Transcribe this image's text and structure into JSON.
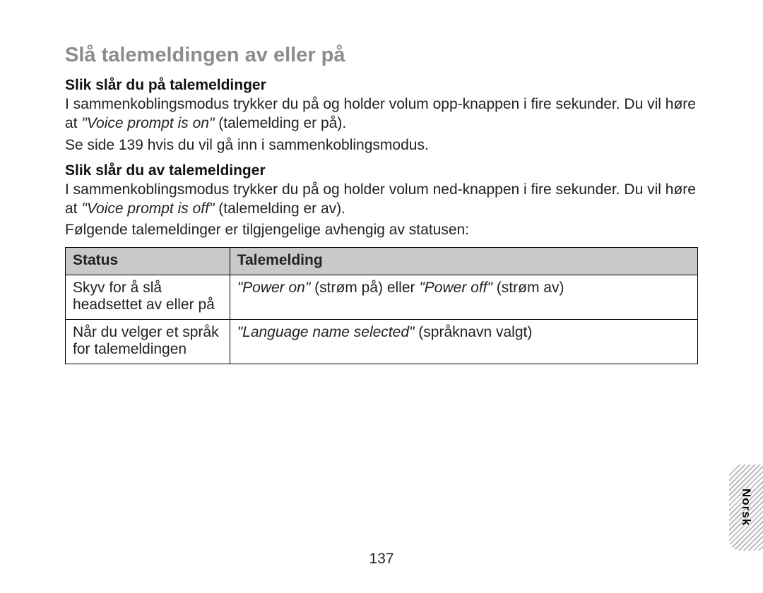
{
  "title": "Slå talemeldingen av eller på",
  "sec_on": {
    "heading": "Slik slår du på talemeldinger",
    "p1a": "I sammenkoblingsmodus trykker du på og holder volum opp-knappen i fire sekunder. Du vil høre at ",
    "p1q": "\"Voice prompt is on\"",
    "p1b": " (talemelding er på).",
    "p2": "Se side 139 hvis du vil gå inn i sammenkoblingsmodus."
  },
  "sec_off": {
    "heading": "Slik slår du av talemeldinger",
    "p1a": "I sammenkoblingsmodus trykker du på og holder volum ned-knappen i fire sekunder. Du vil høre at ",
    "p1q": "\"Voice prompt is off\"",
    "p1b": " (talemelding er av).",
    "p2": "Følgende talemeldinger er tilgjengelige avhengig av statusen:"
  },
  "table": {
    "col_status": "Status",
    "col_msg": "Talemelding",
    "rows": [
      {
        "status": "Skyv for å slå headsettet av eller på",
        "msg_i1": "\"Power on\"",
        "msg_t1": " (strøm på) eller ",
        "msg_i2": "\"Power off\"",
        "msg_t2": " (strøm av)"
      },
      {
        "status": "Når du velger et språk for talemeldingen",
        "msg_i1": "\"Language name selected\"",
        "msg_t1": " (språknavn valgt)",
        "msg_i2": "",
        "msg_t2": ""
      }
    ]
  },
  "page_number": "137",
  "language_tab": "Norsk"
}
